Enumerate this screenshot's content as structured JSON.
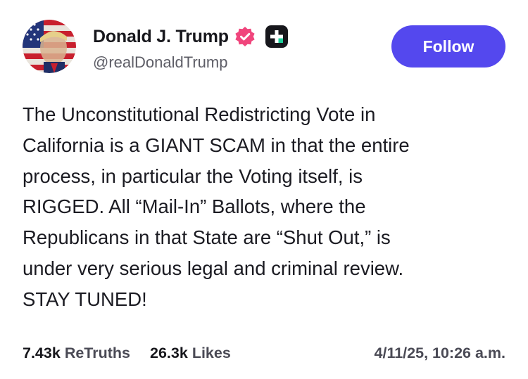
{
  "author": {
    "display_name": "Donald J. Trump",
    "handle": "@realDonaldTrump",
    "avatar_icon": "profile-photo-icon",
    "verified_icon": "verified-badge-icon",
    "verified_color": "#f0457c",
    "plus_icon": "truth-plus-badge-icon"
  },
  "follow_button": {
    "label": "Follow",
    "color": "#5448ee"
  },
  "post": {
    "lines": [
      "The Unconstitutional Redistricting Vote in",
      "California is a GIANT SCAM in that the entire",
      "process, in particular the Voting itself, is",
      "RIGGED. All “Mail-In” Ballots, where the",
      "Republicans in that State are “Shut Out,” is",
      "under very serious legal and criminal review.",
      "STAY TUNED!"
    ]
  },
  "stats": {
    "retruths_count": "7.43k",
    "retruths_label": "ReTruths",
    "likes_count": "26.3k",
    "likes_label": "Likes",
    "timestamp": "4/11/25, 10:26 a.m."
  }
}
